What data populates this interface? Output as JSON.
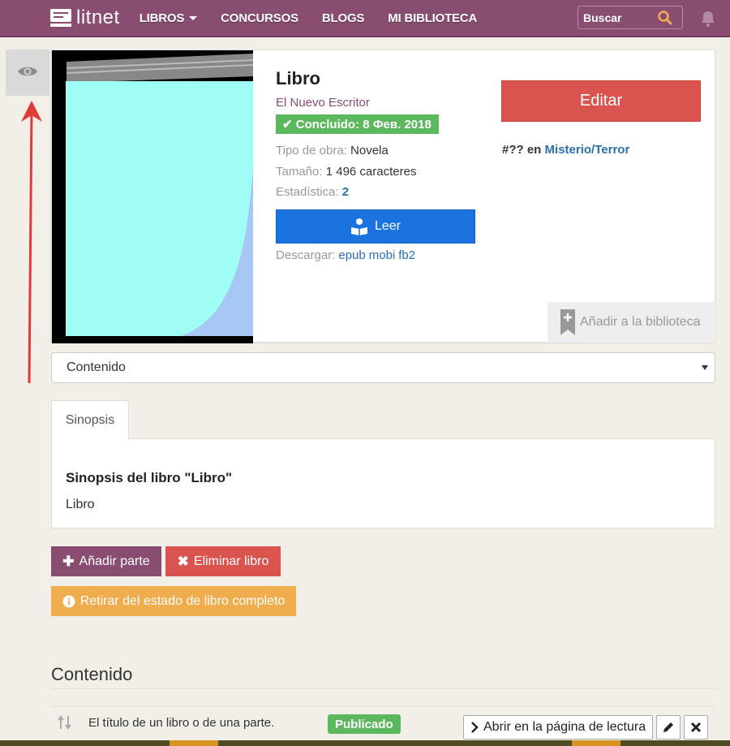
{
  "nav": {
    "logo": "litnet",
    "links": [
      "LIBROS",
      "CONCURSOS",
      "BLOGS",
      "MI BIBLIOTECA"
    ],
    "search_placeholder": "Buscar"
  },
  "book": {
    "title": "Libro",
    "author": "El Nuevo Escritor",
    "status": "Concluido: 8 Фев. 2018",
    "type_label": "Tipo de obra:",
    "type_value": "Novela",
    "size_label": "Tamaño:",
    "size_value": "1 496 caracteres",
    "stats_label": "Estadística:",
    "stats_value": "2",
    "read_label": "Leer",
    "download_label": "Descargar:",
    "download_formats": [
      "epub",
      "mobi",
      "fb2"
    ],
    "edit_label": "Editar",
    "rank": "#??",
    "rank_in": "en",
    "genre": "Misterio/Terror",
    "add_library_label": "Añadir a la biblioteca"
  },
  "contents_select": {
    "selected": "Contenido"
  },
  "tabs": [
    {
      "label": "Sinopsis"
    }
  ],
  "synopsis": {
    "title": "Sinopsis del libro \"Libro\"",
    "text": "Libro"
  },
  "actions": {
    "add_part": "Añadir parte",
    "delete_book": "Eliminar libro",
    "withdraw": "Retirar del estado de libro completo"
  },
  "contents": {
    "heading": "Contenido",
    "rows": [
      {
        "title": "El título de un libro o de una parte.",
        "badge": "Publicado",
        "open_label": "Abrir en la página de lectura"
      }
    ]
  },
  "colors": {
    "navbar": "#8a4d72",
    "primary_blue": "#1b73e0",
    "danger": "#d9534f",
    "success": "#5cb85c",
    "warning": "#f0ad4e",
    "annotation_arrow": "#e03a3a"
  }
}
